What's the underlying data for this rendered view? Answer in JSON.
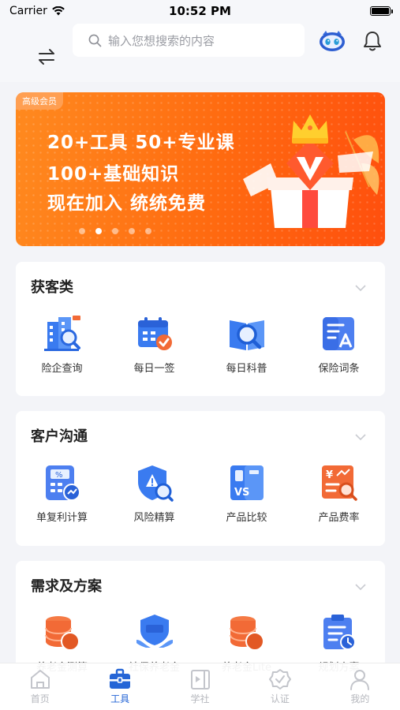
{
  "status": {
    "carrier": "Carrier",
    "time": "10:52 PM"
  },
  "search": {
    "placeholder": "输入您想搜索的内容"
  },
  "banner": {
    "tag": "高级会员",
    "line1": "20+工具  50+专业课",
    "line2": "100+基础知识",
    "line3": "现在加入  统统免费",
    "pages": 5,
    "active_page": 2
  },
  "sections": [
    {
      "title": "获客类",
      "items": [
        {
          "label": "险企查询",
          "icon": "building-search-icon"
        },
        {
          "label": "每日一签",
          "icon": "calendar-check-icon"
        },
        {
          "label": "每日科普",
          "icon": "book-search-icon"
        },
        {
          "label": "保险词条",
          "icon": "document-a-icon"
        }
      ]
    },
    {
      "title": "客户沟通",
      "items": [
        {
          "label": "单复利计算",
          "icon": "calculator-icon"
        },
        {
          "label": "风险精算",
          "icon": "shield-alert-icon"
        },
        {
          "label": "产品比较",
          "icon": "versus-compare-icon"
        },
        {
          "label": "产品费率",
          "icon": "rate-table-icon"
        }
      ]
    },
    {
      "title": "需求及方案",
      "items": [
        {
          "label": "养老金测算",
          "icon": "pension-coins-icon"
        },
        {
          "label": "社保养老金",
          "icon": "social-security-icon"
        },
        {
          "label": "养老金Lite",
          "icon": "lite-coins-icon"
        },
        {
          "label": "规划方案",
          "icon": "clipboard-plan-icon"
        }
      ]
    }
  ],
  "tabs": [
    {
      "label": "首页",
      "icon": "home-icon"
    },
    {
      "label": "工具",
      "icon": "toolbox-icon",
      "active": true
    },
    {
      "label": "学社",
      "icon": "play-book-icon"
    },
    {
      "label": "认证",
      "icon": "badge-check-icon"
    },
    {
      "label": "我的",
      "icon": "person-icon"
    }
  ],
  "colors": {
    "accent": "#2565d6",
    "banner": "#ff6a10",
    "orange_icon": "#f26a36"
  }
}
